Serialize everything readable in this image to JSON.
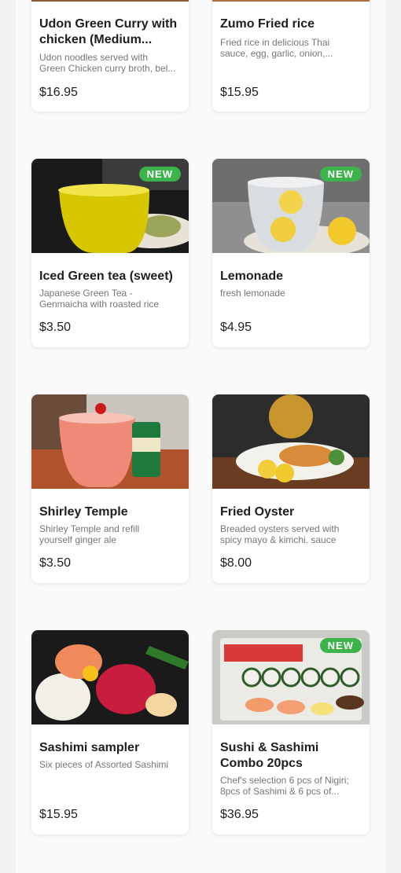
{
  "menu": {
    "items": [
      {
        "title": "Udon Green Curry with chicken (Medium...",
        "desc_line1": "Udon noodles served with",
        "desc_line2": "Green Chicken curry broth, bel...",
        "price": "$16.95"
      },
      {
        "title": "Zumo Fried rice",
        "desc_line1": "Fried rice in delicious Thai",
        "desc_line2": "sauce, egg, garlic, onion,...",
        "price": "$15.95"
      },
      {
        "title": "Iced Green tea (sweet)",
        "desc_line1": "Japanese Green Tea -",
        "desc_line2": "Genmaicha with roasted rice",
        "price": "$3.50",
        "badge": "NEW"
      },
      {
        "title": "Lemonade",
        "desc_line1": "fresh lemonade",
        "desc_line2": "",
        "price": "$4.95",
        "badge": "NEW"
      },
      {
        "title": "Shirley Temple",
        "desc_line1": "Shirley Temple and refill",
        "desc_line2": "yourself ginger ale",
        "price": "$3.50"
      },
      {
        "title": "Fried Oyster",
        "desc_line1": "Breaded oysters served with",
        "desc_line2": "spicy mayo & kimchi. sauce",
        "price": "$8.00"
      },
      {
        "title": "Sashimi sampler",
        "desc_line1": "Six pieces of Assorted Sashimi",
        "desc_line2": "",
        "price": "$15.95"
      },
      {
        "title": "Sushi & Sashimi Combo 20pcs",
        "desc_line1": "Chef's selection 6 pcs of Nigiri;",
        "desc_line2": "8pcs of Sashimi & 6 pcs of...",
        "price": "$36.95",
        "badge": "NEW"
      }
    ]
  },
  "colors": {
    "badge": "#3cb44b",
    "price": "#1e1e1e",
    "description": "#777777"
  }
}
